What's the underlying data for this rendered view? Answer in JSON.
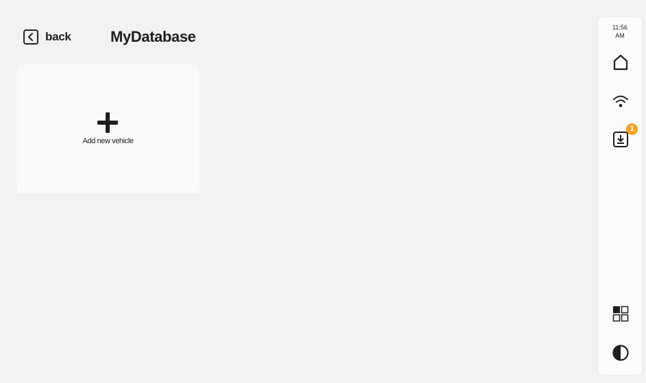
{
  "header": {
    "back_label": "back",
    "title": "MyDatabase"
  },
  "add_vehicle_card": {
    "label": "Add new vehicle",
    "icon": "plus-icon"
  },
  "sidebar": {
    "time": "11:56",
    "ampm": "AM",
    "icons": [
      "home-icon",
      "wifi-icon",
      "download-icon",
      "apps-grid-icon",
      "contrast-icon"
    ],
    "download_badge": "1",
    "badge_color": "#f5a21e"
  }
}
